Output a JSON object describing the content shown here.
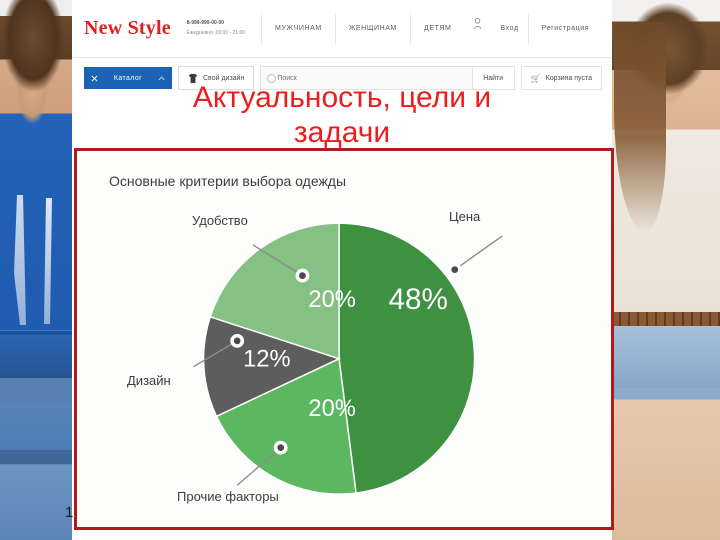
{
  "slide": {
    "title_line1": "Актуальность, цели и",
    "title_line2": "задачи",
    "title_color": "#ee1c1c",
    "page_number": "1"
  },
  "site": {
    "brand": "New Style",
    "phone": "8-999-999-00-00",
    "hours": "Ежедневно: 09:00 - 21:00",
    "nav": [
      {
        "label": "МУЖЧИНАМ"
      },
      {
        "label": "ЖЕНЩИНАМ"
      },
      {
        "label": "ДЕТЯМ"
      }
    ],
    "account": {
      "icon": "person-icon",
      "login": "Вход",
      "register": "Регистрация"
    },
    "tools": {
      "catalog": "Каталог",
      "catalog_icon": "menu-icon",
      "catalog_chevron": "chevron-up-icon",
      "catalog_bg": "#1b64b5",
      "design": "Свой дизайн",
      "design_icon": "tshirt-icon",
      "search_placeholder": "Поиск",
      "search_value": "",
      "search_icon": "search-icon",
      "find": "Найти",
      "cart": "Корзина пуста",
      "cart_icon": "cart-icon"
    }
  },
  "chart_data": {
    "type": "pie",
    "title": "Основные критерии выбора одежды",
    "categories": [
      "Цена",
      "Прочие факторы",
      "Дизайн",
      "Удобство"
    ],
    "values": [
      48,
      20,
      12,
      20
    ],
    "value_labels": [
      "48%",
      "20%",
      "12%",
      "20%"
    ],
    "colors": [
      "#3d9140",
      "#5cb860",
      "#5d5d5d",
      "#84c182"
    ],
    "start_angle": 0,
    "direction": "clockwise",
    "legend": "callout-labels",
    "grid": false,
    "labels": {
      "cena": "Цена",
      "prochie": "Прочие факторы",
      "dizayn": "Дизайн",
      "udobstvo": "Удобство"
    },
    "card_border_color": "#b01a1a"
  }
}
